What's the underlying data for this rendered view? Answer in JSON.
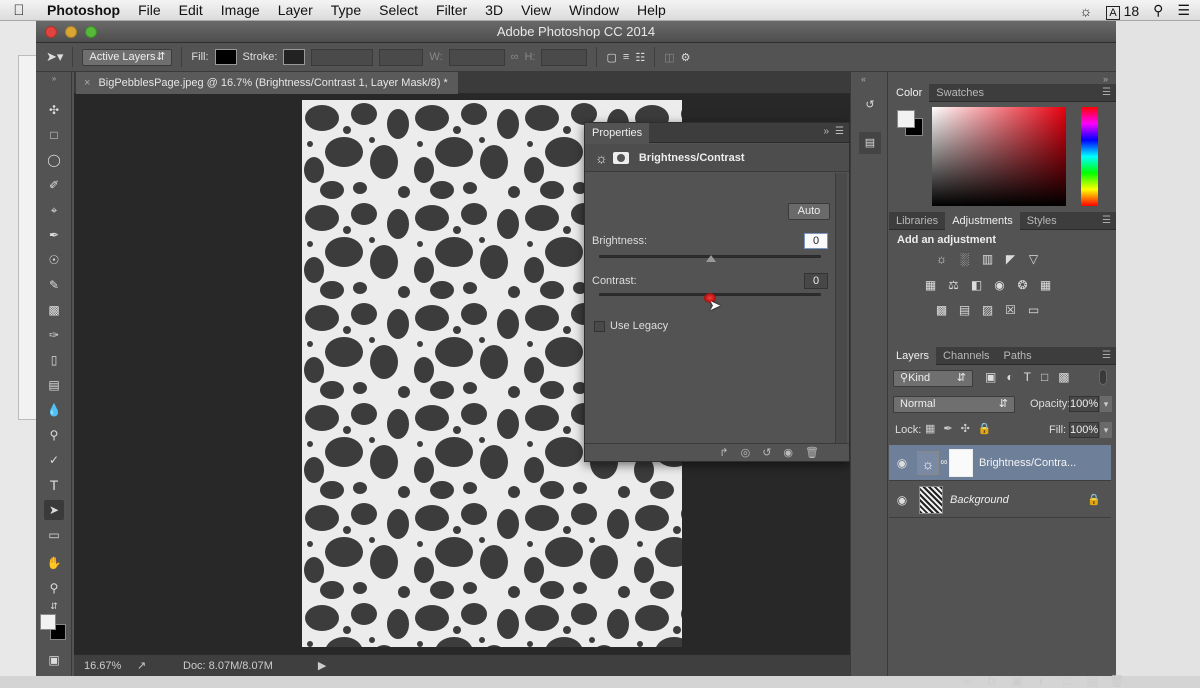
{
  "menubar": {
    "apple": "",
    "app": "Photoshop",
    "items": [
      "File",
      "Edit",
      "Image",
      "Layer",
      "Type",
      "Select",
      "Filter",
      "3D",
      "View",
      "Window",
      "Help"
    ],
    "notifications": "18"
  },
  "window": {
    "title": "Adobe Photoshop CC 2014"
  },
  "options": {
    "sample_select": "Active Layers",
    "fill_label": "Fill:",
    "stroke_label": "Stroke:",
    "w_label": "W:",
    "h_label": "H:"
  },
  "document": {
    "tab_title": "BigPebblesPage.jpeg @ 16.7% (Brightness/Contrast 1, Layer Mask/8) *",
    "zoom": "16.67%",
    "doc_info": "Doc: 8.07M/8.07M"
  },
  "properties": {
    "tab": "Properties",
    "title": "Brightness/Contrast",
    "auto_label": "Auto",
    "brightness_label": "Brightness:",
    "brightness_value": "0",
    "contrast_label": "Contrast:",
    "contrast_value": "0",
    "legacy_label": "Use Legacy"
  },
  "color_panel": {
    "tabs": [
      "Color",
      "Swatches"
    ]
  },
  "adjust_panel": {
    "tabs": [
      "Libraries",
      "Adjustments",
      "Styles"
    ],
    "heading": "Add an adjustment"
  },
  "layers_panel": {
    "tabs": [
      "Layers",
      "Channels",
      "Paths"
    ],
    "kind_label": "Kind",
    "blend_mode": "Normal",
    "opacity_label": "Opacity:",
    "opacity_value": "100%",
    "lock_label": "Lock:",
    "fill_label": "Fill:",
    "fill_value": "100%",
    "layers": [
      {
        "name": "Brightness/Contra..."
      },
      {
        "name": "Background"
      }
    ]
  },
  "colors": {
    "accent": "#6e7f99",
    "panel": "#535353",
    "canvas": "#282828"
  }
}
